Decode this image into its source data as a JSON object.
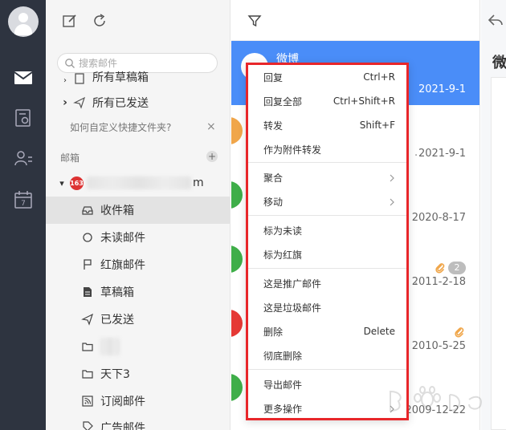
{
  "rail": {
    "items": [
      {
        "icon": "mail-icon",
        "active": true
      },
      {
        "icon": "contacts-book-icon"
      },
      {
        "icon": "person-list-icon"
      },
      {
        "icon": "calendar-icon",
        "text": "7"
      }
    ]
  },
  "folders": {
    "search_placeholder": "搜索邮件",
    "partial_top": "所有草稿箱",
    "all_sent": "所有已发送",
    "hint": "如何自定义快捷文件夹?",
    "hint_close": "×",
    "section_label": "邮箱",
    "section_add": "+",
    "account_badge": "163",
    "account_suffix": "m",
    "items": [
      {
        "label": "收件箱",
        "icon": "inbox-icon",
        "active": true
      },
      {
        "label": "未读邮件",
        "icon": "circle-icon"
      },
      {
        "label": "红旗邮件",
        "icon": "flag-icon"
      },
      {
        "label": "草稿箱",
        "icon": "draft-icon"
      },
      {
        "label": "已发送",
        "icon": "send-icon"
      },
      {
        "label": "",
        "icon": "folder-icon",
        "blurred": true
      },
      {
        "label": "天下3",
        "icon": "folder-icon"
      },
      {
        "label": "订阅邮件",
        "icon": "rss-icon"
      },
      {
        "label": "广告邮件",
        "icon": "tag-icon"
      }
    ]
  },
  "list": {
    "messages": [
      {
        "sender": "微博",
        "date": "2021-9-1",
        "selected": true,
        "color": "#ffffff"
      },
      {
        "sender": "",
        "date": "2021-9-1",
        "color": "#f0a64a"
      },
      {
        "sender": "",
        "date": "2020-8-17",
        "color": "#3fae49"
      },
      {
        "sender": "",
        "date": "2011-2-18",
        "color": "#3fae49",
        "attachment": true,
        "count": "2"
      },
      {
        "sender": "",
        "date": "2010-5-25",
        "color": "#e53935",
        "attachment": true
      },
      {
        "sender": "",
        "date": "2009-12-22",
        "color": "#3fae49"
      }
    ],
    "snippet_dot": "."
  },
  "reader": {
    "title_partial": "微"
  },
  "menu": {
    "items": [
      {
        "label": "回复",
        "key": "Ctrl+R"
      },
      {
        "label": "回复全部",
        "key": "Ctrl+Shift+R"
      },
      {
        "label": "转发",
        "key": "Shift+F"
      },
      {
        "label": "作为附件转发",
        "key": ""
      },
      {
        "label": "聚合",
        "submenu": true
      },
      {
        "label": "移动",
        "submenu": true
      },
      {
        "label": "标为未读",
        "key": ""
      },
      {
        "label": "标为红旗",
        "key": ""
      },
      {
        "label": "这是推广邮件",
        "key": ""
      },
      {
        "label": "这是垃圾邮件",
        "key": ""
      },
      {
        "label": "删除",
        "key": "Delete"
      },
      {
        "label": "彻底删除",
        "key": ""
      },
      {
        "label": "导出邮件",
        "key": ""
      },
      {
        "label": "更多操作",
        "submenu": true
      }
    ]
  },
  "colors": {
    "accent": "#4a8df8",
    "highlight_border": "#e8262a",
    "rail_bg": "#2e3440"
  }
}
